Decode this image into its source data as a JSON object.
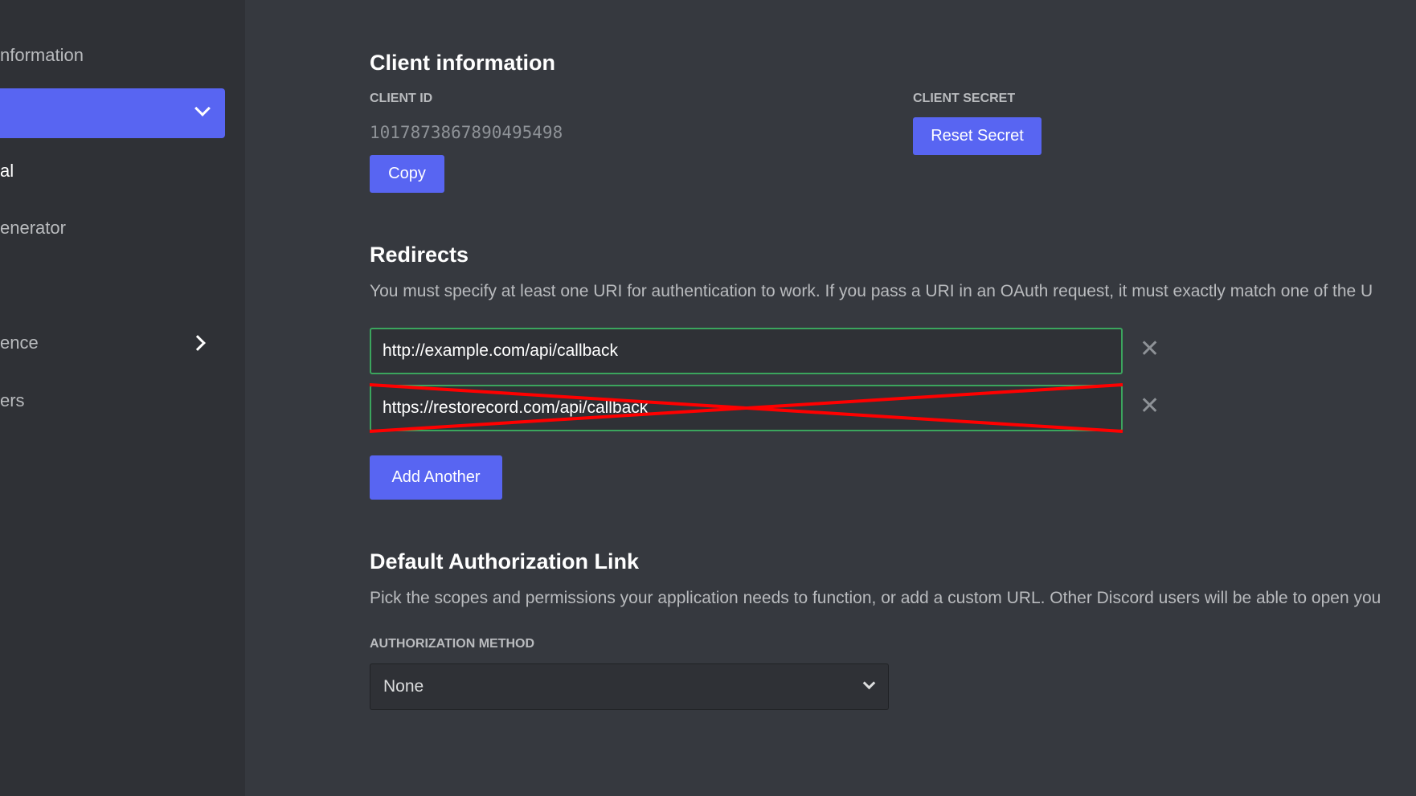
{
  "sidebar": {
    "items": [
      {
        "label": "nformation"
      },
      {
        "label": ""
      },
      {
        "label": "al"
      },
      {
        "label": "enerator"
      },
      {
        "label": "ence"
      },
      {
        "label": "ers"
      }
    ]
  },
  "client": {
    "title": "Client information",
    "id_label": "CLIENT ID",
    "id_value": "1017873867890495498",
    "copy": "Copy",
    "secret_label": "CLIENT SECRET",
    "reset": "Reset Secret"
  },
  "redirects": {
    "title": "Redirects",
    "description": "You must specify at least one URI for authentication to work. If you pass a URI in an OAuth request, it must exactly match one of the U",
    "urls": [
      "http://example.com/api/callback",
      "https://restorecord.com/api/callback"
    ],
    "add": "Add Another"
  },
  "auth": {
    "title": "Default Authorization Link",
    "description": "Pick the scopes and permissions your application needs to function, or add a custom URL. Other Discord users will be able to open you",
    "method_label": "AUTHORIZATION METHOD",
    "method_value": "None"
  },
  "colors": {
    "accent": "#5865f2",
    "valid": "#3ba55d",
    "strike": "#ff0000"
  }
}
